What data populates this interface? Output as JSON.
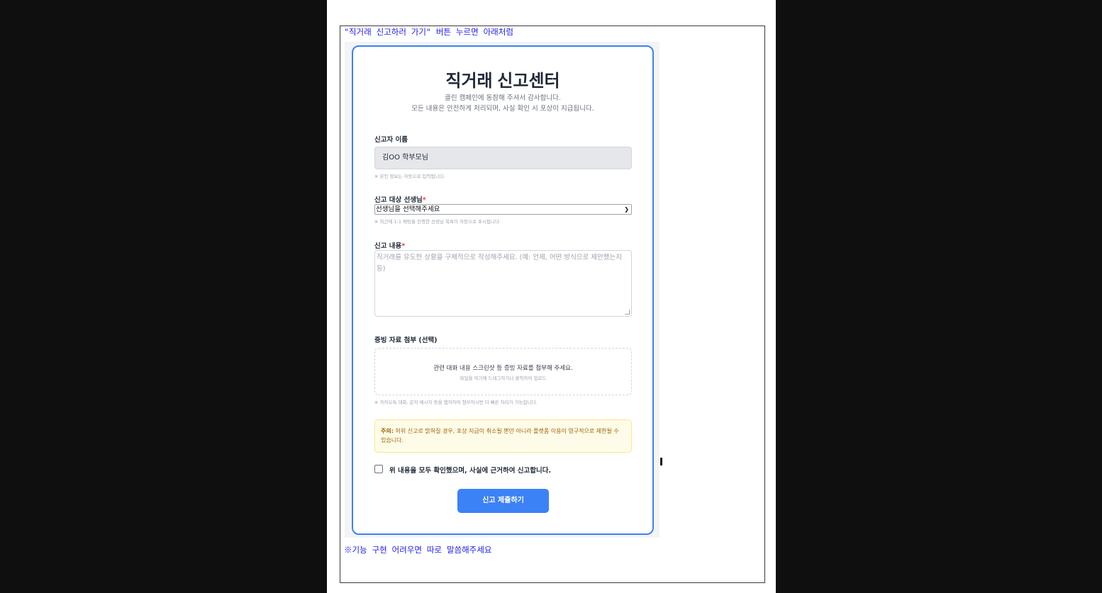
{
  "document": {
    "top_note": "\"직거래 신고하러 가기\" 버튼 누르면 아래처럼",
    "bottom_note": "※기능 구현 어려우면 따로 말씀해주세요"
  },
  "form": {
    "title": "직거래 신고센터",
    "subtitle_line1": "클린 캠페인에 동참해 주셔서 감사합니다.",
    "subtitle_line2": "모든 내용은 안전하게 처리되며, 사실 확인 시 포상이 지급됩니다.",
    "reporter": {
      "label": "신고자 이름",
      "value": "김OO 학부모님",
      "helper": "※ 본인 정보는 자동으로 입력됩니다."
    },
    "target": {
      "label": "신고 대상 선생님",
      "required_mark": "*",
      "selected": "선생님을 선택해주세요",
      "helper": "※ 최근에 1:1 채팅을 진행한 선생님 목록이 자동으로 표시됩니다."
    },
    "content": {
      "label": "신고 내용",
      "required_mark": "*",
      "placeholder": "직거래를 유도한 상황을 구체적으로 작성해주세요. (예: 언제, 어떤 방식으로 제안했는지 등)"
    },
    "evidence": {
      "label": "증빙 자료 첨부 (선택)",
      "drop_main": "관련 대화 내용 스크린샷 등 증빙 자료를 첨부해 주세요.",
      "drop_sub": "파일을 여기에 드래그하거나 클릭하여 업로드",
      "helper": "※ 카카오톡 대화, 문자 메시지 등을 캡처하여 첨부하시면 더 빠른 처리가 가능합니다."
    },
    "warning": {
      "prefix": "주의:",
      "text": " 허위 신고로 밝혀질 경우, 포상 지급이 취소될 뿐만 아니라 플랫폼 이용이 영구적으로 제한될 수 있습니다."
    },
    "confirm_label": "위 내용을 모두 확인했으며, 사실에 근거하여 신고합니다.",
    "submit_label": "신고 제출하기",
    "colors": {
      "accent": "#3b82f6",
      "required": "#ef4444",
      "warning_text": "#a16207",
      "warning_bg": "#fefce8"
    }
  }
}
